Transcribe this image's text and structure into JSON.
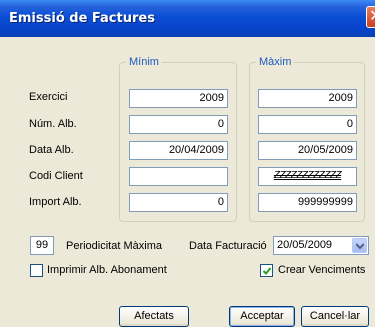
{
  "window": {
    "title": "Emissió de Factures"
  },
  "groups": {
    "min_label": "Mínim",
    "max_label": "Màxim"
  },
  "rows": [
    {
      "label": "Exercici",
      "min": "2009",
      "max": "2009"
    },
    {
      "label": "Núm. Alb.",
      "min": "0",
      "max": "0"
    },
    {
      "label": "Data Alb.",
      "min": "20/04/2009",
      "max": "20/05/2009"
    },
    {
      "label": "Codi Client",
      "min": "",
      "max": "ZZZZZZZZZZZZ"
    },
    {
      "label": "Import Alb.",
      "min": "0",
      "max": "999999999"
    }
  ],
  "periodicitat": {
    "value": "99",
    "label": "Periodicitat Màxima"
  },
  "data_facturacio": {
    "label": "Data Facturació",
    "value": "20/05/2009"
  },
  "checkboxes": {
    "imprimir": {
      "label": "Imprimir Alb. Abonament",
      "checked": false
    },
    "crear": {
      "label": "Crear Venciments",
      "checked": true
    }
  },
  "buttons": {
    "afectats": "Afectats",
    "acceptar": "Acceptar",
    "cancel": "Cancel·lar"
  }
}
